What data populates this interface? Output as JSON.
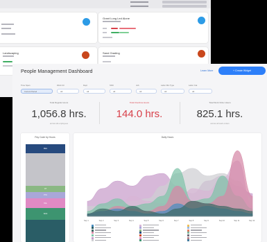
{
  "back_window": {
    "cards": [
      {
        "title": "",
        "icon": "check-icon",
        "icon_color": "#2d9be6"
      },
      {
        "title": "Grant Lung Led Alone",
        "icon": "check-icon",
        "icon_color": "#2d9be6"
      },
      {
        "title": "Landscaping",
        "icon": "flame-icon",
        "icon_color": "#c9471c"
      },
      {
        "title": "Sand Grading",
        "icon": "flame-icon",
        "icon_color": "#c9471c"
      }
    ]
  },
  "dashboard": {
    "title": "People Management Dashboard",
    "learn_more": "Learn More",
    "create_button": "+ Create Widget",
    "filters": [
      {
        "label": "Time Span"
      },
      {
        "label": "Work Ctr"
      },
      {
        "label": "Dept"
      },
      {
        "label": "Shift"
      },
      {
        "label": "Job"
      },
      {
        "label": "Labor Mix Type"
      },
      {
        "label": "Labor Cat"
      }
    ],
    "filter_chips": [
      {
        "text": "Current Period",
        "selected": true
      },
      {
        "text": "All",
        "selected": false
      },
      {
        "text": "All",
        "selected": false
      },
      {
        "text": "All",
        "selected": false
      },
      {
        "text": "All",
        "selected": false
      },
      {
        "text": "All",
        "selected": false
      },
      {
        "text": "All",
        "selected": false
      }
    ],
    "stats": [
      {
        "label": "Total Regular Hours",
        "value": "1,056.8 hrs.",
        "sub": "across all employees",
        "alert": false
      },
      {
        "label": "Total Overtime Hours",
        "value": "144.0 hrs.",
        "sub": "",
        "alert": true
      },
      {
        "label": "Total Work Order Hours",
        "value": "825.1 hrs.",
        "sub": "across all work orders",
        "alert": false
      }
    ],
    "left_panel": {
      "title": "Pay Code by Hours",
      "segments": [
        {
          "label": "REG",
          "color": "#274a7e",
          "fraction": 0.095
        },
        {
          "label": "",
          "color": "#c4c4c9",
          "fraction": 0.33
        },
        {
          "label": "OT",
          "color": "#8ab883",
          "fraction": 0.065
        },
        {
          "label": "PTO",
          "color": "#a9a7d8",
          "fraction": 0.065
        },
        {
          "label": "HOL",
          "color": "#e08ac4",
          "fraction": 0.1
        },
        {
          "label": "SICK",
          "color": "#3d9470",
          "fraction": 0.12
        },
        {
          "label": "",
          "color": "#2a5d66",
          "fraction": 0.225
        }
      ]
    },
    "right_panel": {
      "title": "Daily Hours"
    }
  },
  "chart_data": {
    "type": "area",
    "title": "Daily Hours",
    "x": [
      "Sep 1",
      "Sep 2",
      "Sep 3",
      "Sep 4",
      "Sep 5",
      "Sep 6",
      "Sep 7",
      "Sep 8",
      "Sep 9",
      "Sep 10",
      "Sep 11",
      "Sep 12"
    ],
    "series": [
      {
        "color": "#c79ccb",
        "values": [
          30,
          55,
          70,
          60,
          80,
          85,
          60,
          45,
          70,
          80,
          60,
          45
        ]
      },
      {
        "color": "#cfcfd3",
        "values": [
          20,
          20,
          25,
          30,
          35,
          60,
          85,
          95,
          80,
          85,
          70,
          35
        ]
      },
      {
        "color": "#d8b6d6",
        "values": [
          5,
          10,
          15,
          40,
          30,
          25,
          20,
          55,
          50,
          75,
          110,
          20
        ]
      },
      {
        "color": "#7fc3a9",
        "values": [
          10,
          25,
          35,
          20,
          25,
          40,
          95,
          30,
          35,
          80,
          40,
          15
        ]
      },
      {
        "color": "#d688a6",
        "values": [
          5,
          10,
          20,
          15,
          10,
          20,
          60,
          30,
          25,
          40,
          130,
          40
        ]
      },
      {
        "color": "#4a8ec0",
        "values": [
          5,
          10,
          15,
          10,
          5,
          10,
          25,
          15,
          20,
          15,
          10,
          5
        ]
      },
      {
        "color": "#3f6b66",
        "values": [
          5,
          15,
          10,
          20,
          10,
          5,
          15,
          30,
          25,
          20,
          15,
          10
        ]
      }
    ],
    "legend_placement": "bottom",
    "legend_swatch_colors": [
      "#4a8ec0",
      "#2a5d66",
      "#3f6b66",
      "#d688a6",
      "#7fc3a9",
      "#c79ccb",
      "#cfcfd3",
      "#d8b6d6",
      "#a9a7d8",
      "#8ab883",
      "#274a7e",
      "#c9471c",
      "#e08ac4",
      "#3d9470",
      "#f0c05a",
      "#9bbbe0",
      "#e07a5f",
      "#81b29a",
      "#6d6875",
      "#b5838d",
      "#457b9d"
    ]
  }
}
